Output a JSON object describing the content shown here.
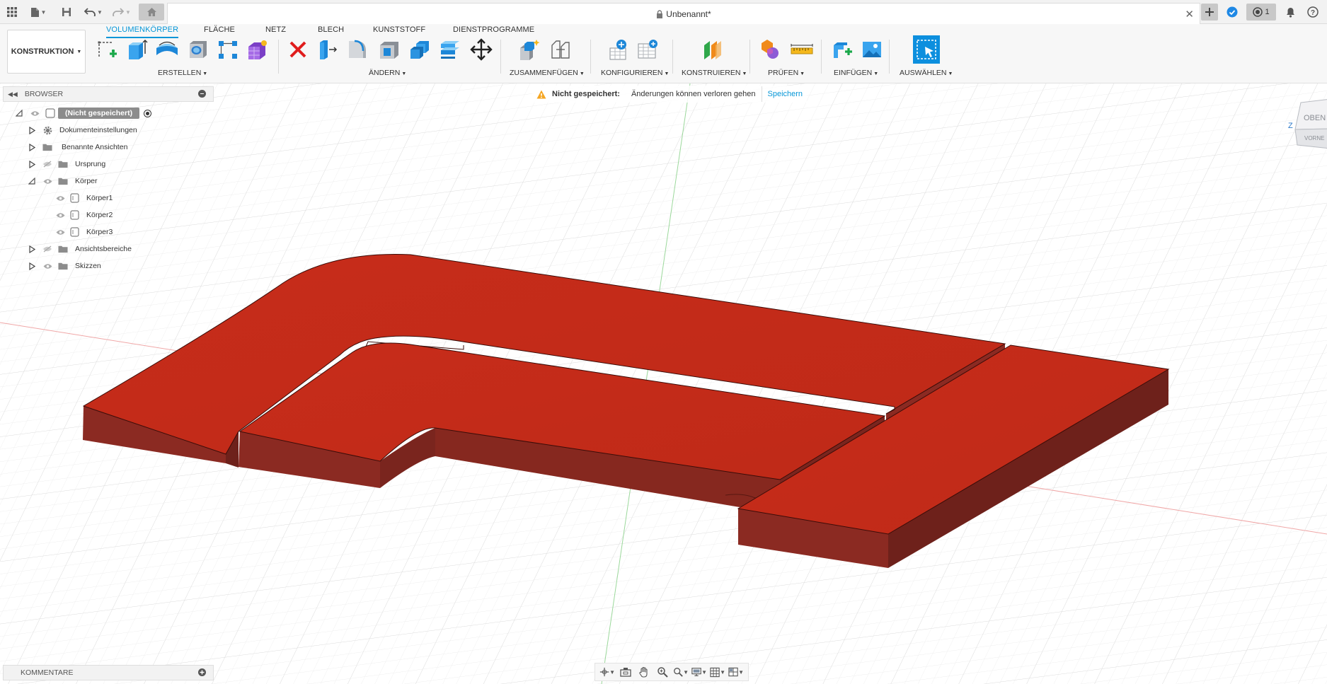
{
  "window": {
    "title": "Unbenannt*",
    "notification_count": "1"
  },
  "toolbar": {
    "workspace": "KONSTRUKTION",
    "tabs": [
      "VOLUMENKÖRPER",
      "FLÄCHE",
      "NETZ",
      "BLECH",
      "KUNSTSTOFF",
      "DIENSTPROGRAMME"
    ],
    "groups": [
      "ERSTELLEN",
      "ÄNDERN",
      "ZUSAMMENFÜGEN",
      "KONFIGURIEREN",
      "KONSTRUIEREN",
      "PRÜFEN",
      "EINFÜGEN",
      "AUSWÄHLEN"
    ]
  },
  "browser": {
    "title": "BROWSER",
    "root": "(Nicht gespeichert)",
    "items": [
      {
        "label": "Dokumenteinstellungen",
        "icon": "gear-icon"
      },
      {
        "label": "Benannte Ansichten",
        "icon": "folder-icon"
      },
      {
        "label": "Ursprung",
        "icon": "folder-icon"
      },
      {
        "label": "Körper",
        "icon": "folder-icon"
      },
      {
        "label": "Körper1",
        "icon": "body-icon"
      },
      {
        "label": "Körper2",
        "icon": "body-icon"
      },
      {
        "label": "Körper3",
        "icon": "body-icon"
      },
      {
        "label": "Ansichtsbereiche",
        "icon": "folder-icon"
      },
      {
        "label": "Skizzen",
        "icon": "folder-icon"
      }
    ]
  },
  "notification": {
    "title": "Nicht gespeichert:",
    "message": "Änderungen können verloren gehen",
    "action": "Speichern"
  },
  "viewcube": {
    "top": "OBEN",
    "front": "VORNE",
    "axis": "Z"
  },
  "comments": {
    "title": "KOMMENTARE"
  },
  "colors": {
    "accent": "#0696d7",
    "body_top": "#c52b1a",
    "body_side": "#8b2a22",
    "body_side_dark": "#6e211b"
  }
}
